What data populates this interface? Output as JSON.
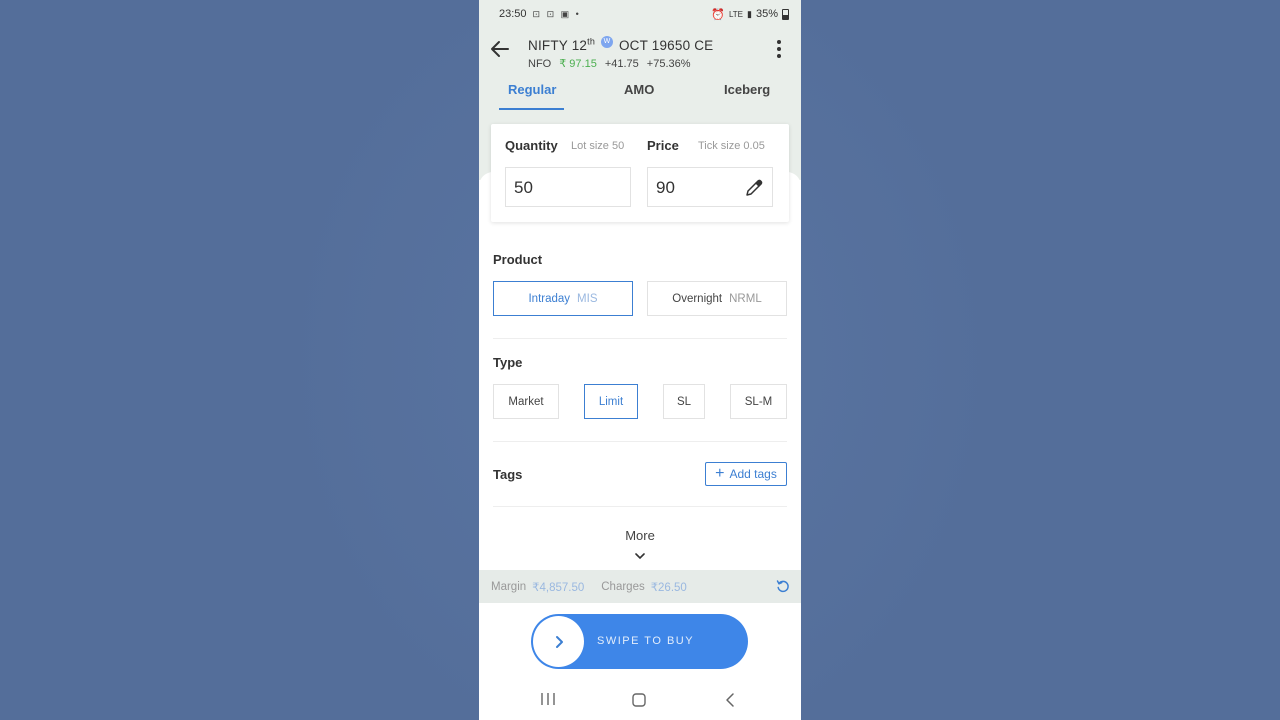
{
  "status_bar": {
    "time": "23:50",
    "battery": "35%",
    "network": "LTE"
  },
  "instrument": {
    "title_pre": "NIFTY 12",
    "title_sup": "th",
    "weekly_badge": "W",
    "title_post": "OCT 19650 CE",
    "exchange": "NFO",
    "ltp": "₹ 97.15",
    "change": "+41.75",
    "change_pct": "+75.36%"
  },
  "tabs": [
    "Regular",
    "AMO",
    "Iceberg"
  ],
  "order": {
    "quantity_label": "Quantity",
    "lot_size_text": "Lot size  50",
    "quantity_value": "50",
    "price_label": "Price",
    "tick_size_text": "Tick size  0.05",
    "price_value": "90"
  },
  "product": {
    "label": "Product",
    "options": [
      {
        "name": "Intraday",
        "code": "MIS"
      },
      {
        "name": "Overnight",
        "code": "NRML"
      }
    ]
  },
  "type": {
    "label": "Type",
    "options": [
      "Market",
      "Limit",
      "SL",
      "SL-M"
    ]
  },
  "tags": {
    "label": "Tags",
    "add_label": "Add tags"
  },
  "more_label": "More",
  "margin": {
    "margin_label": "Margin",
    "margin_value": "₹4,857.50",
    "charges_label": "Charges",
    "charges_value": "₹26.50"
  },
  "swipe_label": "SWIPE TO BUY",
  "colors": {
    "accent": "#3c7fd2",
    "buy_button": "#3e86e8",
    "positive": "#4caf50",
    "background": "#546e9a"
  }
}
